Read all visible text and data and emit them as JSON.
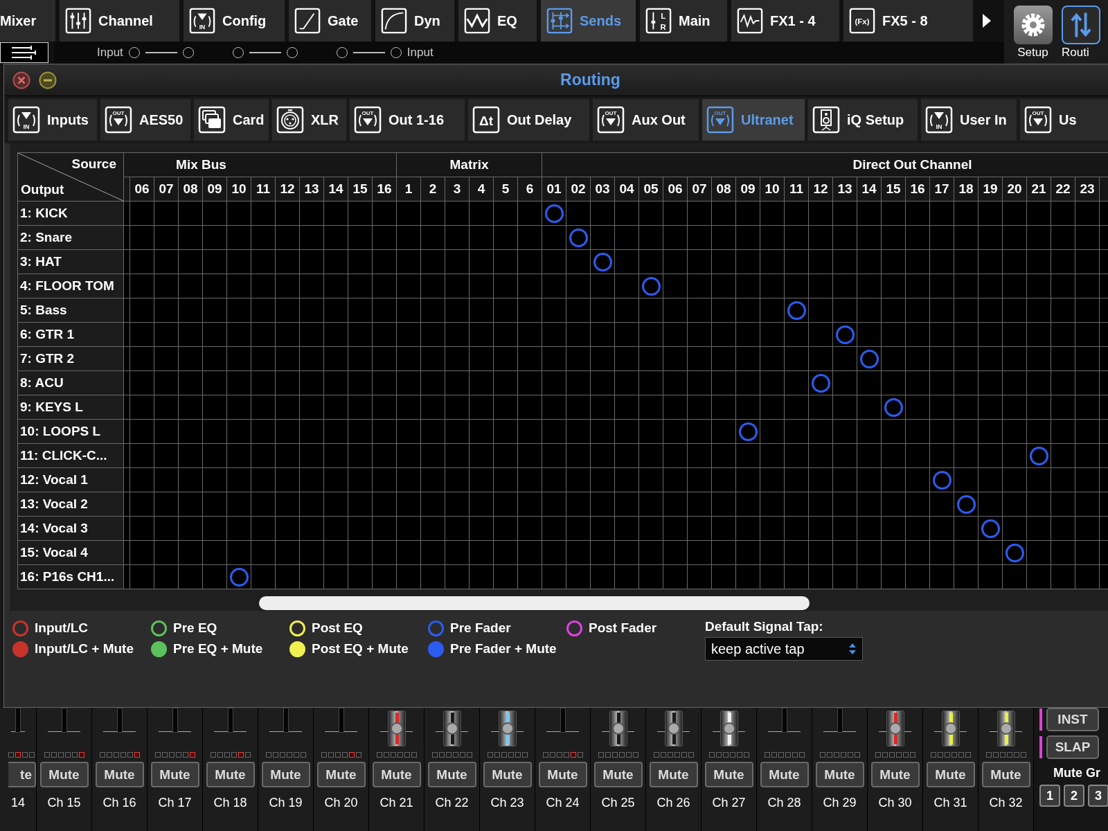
{
  "top_tabs": [
    {
      "label": "Mixer",
      "kind": "none",
      "selected": false
    },
    {
      "label": "Channel",
      "kind": "channel",
      "selected": false
    },
    {
      "label": "Config",
      "kind": "in",
      "icon_text": [
        "IN"
      ],
      "selected": false
    },
    {
      "label": "Gate",
      "kind": "gate",
      "selected": false
    },
    {
      "label": "Dyn",
      "kind": "dyn",
      "selected": false
    },
    {
      "label": "EQ",
      "kind": "eq",
      "selected": false
    },
    {
      "label": "Sends",
      "kind": "sends",
      "selected": true
    },
    {
      "label": "Main",
      "kind": "main",
      "icon_text": [
        "L",
        "R"
      ],
      "selected": false
    },
    {
      "label": "FX1 - 4",
      "kind": "wave",
      "selected": false
    },
    {
      "label": "FX5 - 8",
      "kind": "fx",
      "icon_text": [
        "(Fx)"
      ],
      "selected": false
    }
  ],
  "side_buttons": [
    {
      "label": "Setup",
      "kind": "gear",
      "selected": false
    },
    {
      "label": "Routi",
      "kind": "routing",
      "selected": true
    }
  ],
  "background_strip": {
    "labels": [
      "Input",
      "Input"
    ]
  },
  "window": {
    "title": "Routing",
    "tabs": [
      {
        "label": "Inputs",
        "kind": "in",
        "icon_text": [
          "IN"
        ],
        "selected": false
      },
      {
        "label": "AES50",
        "kind": "out",
        "icon_text": [
          "OUT"
        ],
        "selected": false
      },
      {
        "label": "Card",
        "kind": "card",
        "selected": false
      },
      {
        "label": "XLR",
        "kind": "xlr",
        "selected": false
      },
      {
        "label": "Out 1-16",
        "kind": "out",
        "icon_text": [
          "OUT"
        ],
        "selected": false
      },
      {
        "label": "Out Delay",
        "kind": "delay",
        "icon_text": [
          "Δt"
        ],
        "selected": false
      },
      {
        "label": "Aux Out",
        "kind": "out",
        "icon_text": [
          "OUT"
        ],
        "selected": false
      },
      {
        "label": "Ultranet",
        "kind": "out",
        "icon_text": [
          "OUT"
        ],
        "selected": true
      },
      {
        "label": "iQ Setup",
        "kind": "speaker",
        "selected": false
      },
      {
        "label": "User In",
        "kind": "in",
        "icon_text": [
          "IN"
        ],
        "selected": false
      },
      {
        "label": "Us",
        "kind": "out",
        "icon_text": [
          "OUT"
        ],
        "selected": false
      }
    ]
  },
  "grid": {
    "corner": {
      "source": "Source",
      "output": "Output"
    },
    "groups": [
      {
        "label": "Mix Bus",
        "columns": [
          "06",
          "07",
          "08",
          "09",
          "10",
          "11",
          "12",
          "13",
          "14",
          "15",
          "16"
        ]
      },
      {
        "label": "Matrix",
        "columns": [
          "1",
          "2",
          "3",
          "4",
          "5",
          "6"
        ]
      },
      {
        "label": "Direct Out Channel",
        "columns": [
          "01",
          "02",
          "03",
          "04",
          "05",
          "06",
          "07",
          "08",
          "09",
          "10",
          "11",
          "12",
          "13",
          "14",
          "15",
          "16",
          "17",
          "18",
          "19",
          "20",
          "21",
          "22",
          "23"
        ]
      }
    ],
    "rows": [
      {
        "label": "1: KICK",
        "kind": "pre_fader",
        "cells": [
          false,
          false,
          false,
          false,
          false,
          false,
          false,
          false,
          false,
          false,
          false,
          false,
          false,
          false,
          false,
          false,
          false,
          true,
          false,
          false,
          false,
          false,
          false,
          false,
          false,
          false,
          false,
          false,
          false,
          false,
          false,
          false,
          false,
          false,
          false,
          false,
          false,
          false,
          false,
          false
        ]
      },
      {
        "label": "2: Snare",
        "kind": "pre_fader",
        "cells": [
          false,
          false,
          false,
          false,
          false,
          false,
          false,
          false,
          false,
          false,
          false,
          false,
          false,
          false,
          false,
          false,
          false,
          false,
          true,
          false,
          false,
          false,
          false,
          false,
          false,
          false,
          false,
          false,
          false,
          false,
          false,
          false,
          false,
          false,
          false,
          false,
          false,
          false,
          false,
          false
        ]
      },
      {
        "label": "3: HAT",
        "kind": "pre_fader",
        "cells": [
          false,
          false,
          false,
          false,
          false,
          false,
          false,
          false,
          false,
          false,
          false,
          false,
          false,
          false,
          false,
          false,
          false,
          false,
          false,
          true,
          false,
          false,
          false,
          false,
          false,
          false,
          false,
          false,
          false,
          false,
          false,
          false,
          false,
          false,
          false,
          false,
          false,
          false,
          false,
          false
        ]
      },
      {
        "label": "4: FLOOR TOM",
        "kind": "pre_fader",
        "cells": [
          false,
          false,
          false,
          false,
          false,
          false,
          false,
          false,
          false,
          false,
          false,
          false,
          false,
          false,
          false,
          false,
          false,
          false,
          false,
          false,
          false,
          true,
          false,
          false,
          false,
          false,
          false,
          false,
          false,
          false,
          false,
          false,
          false,
          false,
          false,
          false,
          false,
          false,
          false,
          false
        ]
      },
      {
        "label": "5: Bass",
        "kind": "pre_fader",
        "cells": [
          false,
          false,
          false,
          false,
          false,
          false,
          false,
          false,
          false,
          false,
          false,
          false,
          false,
          false,
          false,
          false,
          false,
          false,
          false,
          false,
          false,
          false,
          false,
          false,
          false,
          false,
          false,
          true,
          false,
          false,
          false,
          false,
          false,
          false,
          false,
          false,
          false,
          false,
          false,
          false
        ]
      },
      {
        "label": "6: GTR 1",
        "kind": "pre_fader",
        "cells": [
          false,
          false,
          false,
          false,
          false,
          false,
          false,
          false,
          false,
          false,
          false,
          false,
          false,
          false,
          false,
          false,
          false,
          false,
          false,
          false,
          false,
          false,
          false,
          false,
          false,
          false,
          false,
          false,
          false,
          true,
          false,
          false,
          false,
          false,
          false,
          false,
          false,
          false,
          false,
          false
        ]
      },
      {
        "label": "7: GTR 2",
        "kind": "pre_fader",
        "cells": [
          false,
          false,
          false,
          false,
          false,
          false,
          false,
          false,
          false,
          false,
          false,
          false,
          false,
          false,
          false,
          false,
          false,
          false,
          false,
          false,
          false,
          false,
          false,
          false,
          false,
          false,
          false,
          false,
          false,
          false,
          true,
          false,
          false,
          false,
          false,
          false,
          false,
          false,
          false,
          false
        ]
      },
      {
        "label": "8: ACU",
        "kind": "pre_fader",
        "cells": [
          false,
          false,
          false,
          false,
          false,
          false,
          false,
          false,
          false,
          false,
          false,
          false,
          false,
          false,
          false,
          false,
          false,
          false,
          false,
          false,
          false,
          false,
          false,
          false,
          false,
          false,
          false,
          false,
          true,
          false,
          false,
          false,
          false,
          false,
          false,
          false,
          false,
          false,
          false,
          false
        ]
      },
      {
        "label": "9: KEYS L",
        "kind": "pre_fader",
        "cells": [
          false,
          false,
          false,
          false,
          false,
          false,
          false,
          false,
          false,
          false,
          false,
          false,
          false,
          false,
          false,
          false,
          false,
          false,
          false,
          false,
          false,
          false,
          false,
          false,
          false,
          false,
          false,
          false,
          false,
          false,
          false,
          true,
          false,
          false,
          false,
          false,
          false,
          false,
          false,
          false
        ]
      },
      {
        "label": "10: LOOPS L",
        "kind": "pre_fader",
        "cells": [
          false,
          false,
          false,
          false,
          false,
          false,
          false,
          false,
          false,
          false,
          false,
          false,
          false,
          false,
          false,
          false,
          false,
          false,
          false,
          false,
          false,
          false,
          false,
          false,
          false,
          true,
          false,
          false,
          false,
          false,
          false,
          false,
          false,
          false,
          false,
          false,
          false,
          false,
          false,
          false
        ]
      },
      {
        "label": "11: CLICK-C...",
        "kind": "pre_fader",
        "cells": [
          false,
          false,
          false,
          false,
          false,
          false,
          false,
          false,
          false,
          false,
          false,
          false,
          false,
          false,
          false,
          false,
          false,
          false,
          false,
          false,
          false,
          false,
          false,
          false,
          false,
          false,
          false,
          false,
          false,
          false,
          false,
          false,
          false,
          false,
          false,
          false,
          false,
          true,
          false,
          false
        ]
      },
      {
        "label": "12: Vocal 1",
        "kind": "pre_fader",
        "cells": [
          false,
          false,
          false,
          false,
          false,
          false,
          false,
          false,
          false,
          false,
          false,
          false,
          false,
          false,
          false,
          false,
          false,
          false,
          false,
          false,
          false,
          false,
          false,
          false,
          false,
          false,
          false,
          false,
          false,
          false,
          false,
          false,
          false,
          true,
          false,
          false,
          false,
          false,
          false,
          false
        ]
      },
      {
        "label": "13: Vocal 2",
        "kind": "pre_fader",
        "cells": [
          false,
          false,
          false,
          false,
          false,
          false,
          false,
          false,
          false,
          false,
          false,
          false,
          false,
          false,
          false,
          false,
          false,
          false,
          false,
          false,
          false,
          false,
          false,
          false,
          false,
          false,
          false,
          false,
          false,
          false,
          false,
          false,
          false,
          false,
          true,
          false,
          false,
          false,
          false,
          false
        ]
      },
      {
        "label": "14: Vocal 3",
        "kind": "pre_fader",
        "cells": [
          false,
          false,
          false,
          false,
          false,
          false,
          false,
          false,
          false,
          false,
          false,
          false,
          false,
          false,
          false,
          false,
          false,
          false,
          false,
          false,
          false,
          false,
          false,
          false,
          false,
          false,
          false,
          false,
          false,
          false,
          false,
          false,
          false,
          false,
          false,
          true,
          false,
          false,
          false,
          false
        ]
      },
      {
        "label": "15: Vocal 4",
        "kind": "pre_fader",
        "cells": [
          false,
          false,
          false,
          false,
          false,
          false,
          false,
          false,
          false,
          false,
          false,
          false,
          false,
          false,
          false,
          false,
          false,
          false,
          false,
          false,
          false,
          false,
          false,
          false,
          false,
          false,
          false,
          false,
          false,
          false,
          false,
          false,
          false,
          false,
          false,
          false,
          true,
          false,
          false,
          false
        ]
      },
      {
        "label": "16: P16s CH1...",
        "kind": "pre_fader",
        "cells": [
          false,
          false,
          false,
          false,
          true,
          false,
          false,
          false,
          false,
          false,
          false,
          false,
          false,
          false,
          false,
          false,
          false,
          false,
          false,
          false,
          false,
          false,
          false,
          false,
          false,
          false,
          false,
          false,
          false,
          false,
          false,
          false,
          false,
          false,
          false,
          false,
          false,
          false,
          false,
          false
        ]
      }
    ]
  },
  "legend": [
    {
      "label": "Input/LC",
      "kind": "ring",
      "color": "#c8332c"
    },
    {
      "label": "Pre EQ",
      "kind": "ring",
      "color": "#5cc05c"
    },
    {
      "label": "Post EQ",
      "kind": "ring",
      "color": "#f0f050"
    },
    {
      "label": "Pre Fader",
      "kind": "ring",
      "color": "#2c5cf0"
    },
    {
      "label": "Post Fader",
      "kind": "ring",
      "color": "#e040e0"
    },
    {
      "label": "Input/LC + Mute",
      "kind": "dot",
      "color": "#c8332c"
    },
    {
      "label": "Pre EQ + Mute",
      "kind": "dot",
      "color": "#5cc05c"
    },
    {
      "label": "Post EQ + Mute",
      "kind": "dot",
      "color": "#f0f050"
    },
    {
      "label": "Pre Fader + Mute",
      "kind": "dot",
      "color": "#2c5cf0"
    }
  ],
  "signal_tap": {
    "label": "Default Signal Tap:",
    "value": "keep active tap"
  },
  "channels": [
    {
      "label": "14",
      "button": "te",
      "kind": "partial",
      "leds": [
        false,
        true,
        false,
        false
      ]
    },
    {
      "label": "Ch 15",
      "button": "Mute",
      "kind": "plain",
      "leds": [
        false,
        false,
        false,
        false,
        false,
        true
      ]
    },
    {
      "label": "Ch 16",
      "button": "Mute",
      "kind": "plain",
      "leds": [
        false,
        false,
        false,
        false,
        false,
        true
      ]
    },
    {
      "label": "Ch 17",
      "button": "Mute",
      "kind": "plain",
      "leds": [
        false,
        false,
        false,
        false,
        false,
        true
      ]
    },
    {
      "label": "Ch 18",
      "button": "Mute",
      "kind": "plain",
      "leds": [
        false,
        false,
        false,
        false,
        true,
        false
      ]
    },
    {
      "label": "Ch 19",
      "button": "Mute",
      "kind": "plain",
      "leds": [
        false,
        false,
        false,
        false,
        false,
        false
      ]
    },
    {
      "label": "Ch 20",
      "button": "Mute",
      "kind": "plain",
      "leds": [
        false,
        false,
        false,
        false,
        true,
        false
      ]
    },
    {
      "label": "Ch 21",
      "button": "Mute",
      "kind": "cap",
      "color": "#e02828",
      "leds": [
        false,
        false,
        false,
        false,
        false,
        false
      ]
    },
    {
      "label": "Ch 22",
      "button": "Mute",
      "kind": "cap",
      "color": "#1a1a1a",
      "leds": [
        false,
        false,
        false,
        false,
        false,
        false
      ]
    },
    {
      "label": "Ch 23",
      "button": "Mute",
      "kind": "cap",
      "color": "#7cc8f0",
      "leds": [
        false,
        false,
        false,
        false,
        false,
        false
      ]
    },
    {
      "label": "Ch 24",
      "button": "Mute",
      "kind": "plain",
      "leds": [
        false,
        false,
        false,
        false,
        true,
        false
      ]
    },
    {
      "label": "Ch 25",
      "button": "Mute",
      "kind": "cap",
      "color": "#1a1a1a",
      "leds": [
        false,
        false,
        false,
        false,
        false,
        false
      ]
    },
    {
      "label": "Ch 26",
      "button": "Mute",
      "kind": "cap",
      "color": "#1a1a1a",
      "leds": [
        false,
        false,
        false,
        false,
        false,
        false
      ]
    },
    {
      "label": "Ch 27",
      "button": "Mute",
      "kind": "cap",
      "color": "#f0f0f0",
      "leds": [
        false,
        false,
        false,
        false,
        false,
        false
      ]
    },
    {
      "label": "Ch 28",
      "button": "Mute",
      "kind": "plain",
      "leds": [
        false,
        false,
        false,
        false,
        false,
        false
      ]
    },
    {
      "label": "Ch 29",
      "button": "Mute",
      "kind": "plain",
      "leds": [
        false,
        false,
        false,
        false,
        false,
        false
      ]
    },
    {
      "label": "Ch 30",
      "button": "Mute",
      "kind": "cap",
      "color": "#e02828",
      "leds": [
        false,
        false,
        false,
        false,
        false,
        false
      ]
    },
    {
      "label": "Ch 31",
      "button": "Mute",
      "kind": "cap",
      "color": "#e8f040",
      "leds": [
        false,
        false,
        false,
        false,
        false,
        false
      ]
    },
    {
      "label": "Ch 32",
      "button": "Mute",
      "kind": "cap",
      "color": "#e8f040",
      "leds": [
        false,
        false,
        false,
        false,
        false,
        false
      ]
    }
  ],
  "scene_buttons": [
    "INST",
    "SLAP"
  ],
  "mute_groups": {
    "title": "Mute Gr",
    "buttons": [
      "1",
      "2",
      "3"
    ]
  }
}
